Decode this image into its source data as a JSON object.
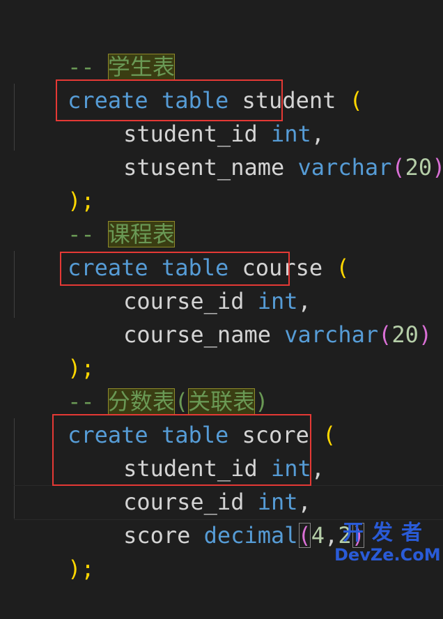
{
  "code": {
    "l1": {
      "dash": "-- ",
      "label": "学生表"
    },
    "l2": {
      "create": "create",
      "table": "table",
      "name": "student",
      "paren": "("
    },
    "l3": {
      "col": "student_id",
      "type": "int",
      "comma": ","
    },
    "l4": {
      "col": "stusent_name",
      "type": "varchar",
      "lp": "(",
      "num": "20",
      "rp": ")"
    },
    "l5": {
      "text": ");"
    },
    "l6": {
      "dash": "-- ",
      "label": "课程表"
    },
    "l7": {
      "create": "create",
      "table": "table",
      "name": "course",
      "paren": "("
    },
    "l8": {
      "col": "course_id",
      "type": "int",
      "comma": ","
    },
    "l9": {
      "col": "course_name",
      "type": "varchar",
      "lp": "(",
      "num": "20",
      "rp": ")"
    },
    "l10": {
      "text": ");"
    },
    "l11": {
      "dash": "-- ",
      "label1": "分数表",
      "lp": "(",
      "label2": "关联表",
      "rp": ")"
    },
    "l12": {
      "create": "create",
      "table": "table",
      "name": "score",
      "paren": "("
    },
    "l13": {
      "col": "student_id",
      "type": "int",
      "comma": ","
    },
    "l14": {
      "col": "course_id",
      "type": "int",
      "comma": ","
    },
    "l15": {
      "col": "score",
      "type": "decimal",
      "lp": "(",
      "n1": "4",
      "sep": ",",
      "n2": "2",
      "rp": ")"
    },
    "l16": {
      "text": ");"
    }
  },
  "watermark": {
    "cn": "开发者",
    "en": "DevZe.CoM"
  },
  "colors": {
    "background": "#1e1e1e",
    "keyword": "#569cd6",
    "identifier": "#d4d4d4",
    "number": "#b5cea8",
    "comment": "#6a9955",
    "bracket_1": "#ffd700",
    "bracket_2": "#da70d6",
    "highlight_box": "#e53935",
    "watermark": "#2a5bd7"
  }
}
